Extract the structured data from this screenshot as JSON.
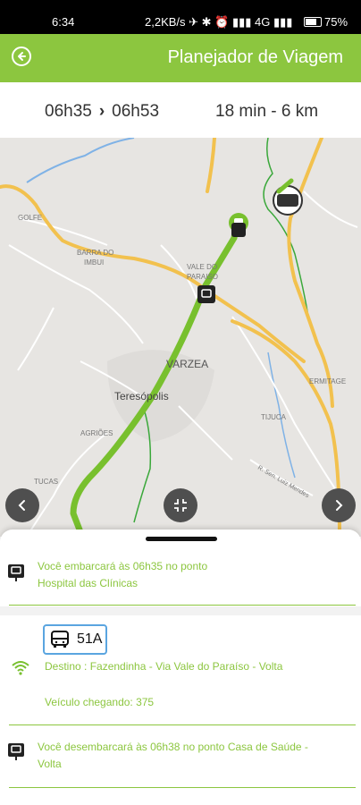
{
  "status_bar": {
    "time": "6:34",
    "network_speed": "2,2KB/s",
    "indicators": "✈ ✱ ⏰ ▮▮▮ 4G ▮▮▮",
    "battery": "75%"
  },
  "app_bar": {
    "title": "Planejador de Viagem",
    "back_icon": "back-circle-icon"
  },
  "trip_header": {
    "depart_time": "06h35",
    "arrow": "›",
    "arrive_time": "06h53",
    "summary": "18 min - 6 km"
  },
  "map": {
    "labels": {
      "golfe": "GOLFE",
      "barra_do_imbui_1": "BARRA DO",
      "barra_do_imbui_2": "IMBUI",
      "vale_1": "VALE DO",
      "vale_2": "PARAISO",
      "varzea": "VARZEA",
      "teresopolis": "Teresópolis",
      "agriões": "AGRIÕES",
      "tijuca": "TIJUCA",
      "ermitage": "ERMITAGE",
      "tucas": "TUCAS",
      "street": "R. Sen. Luiz Mendes"
    },
    "colors": {
      "route": "#78c02e",
      "road": "#f2c14e",
      "water": "#7fb2e6",
      "green_line": "#3aa83a"
    },
    "buttons": [
      "chevron-left-icon",
      "recenter-icon",
      "chevron-right-icon"
    ]
  },
  "sheet": {
    "board_step": {
      "icon": "bus-stop-icon",
      "line1": "Você embarcará às 06h35 no ponto",
      "line2": "Hospital das Clínicas"
    },
    "route": {
      "badge_number": "51A",
      "badge_icon": "bus-icon",
      "realtime_icon": "wifi-signal-icon",
      "destination": "Destino : Fazendinha - Via Vale do Paraíso - Volta",
      "vehicle": "Veículo chegando: 375"
    },
    "alight_step": {
      "icon": "bus-stop-icon",
      "line1": "Você desembarcará às 06h38 no ponto Casa de Saúde -",
      "line2": "Volta"
    }
  },
  "theme": {
    "accent": "#8cc63f",
    "badge_border": "#5aa5e0"
  }
}
